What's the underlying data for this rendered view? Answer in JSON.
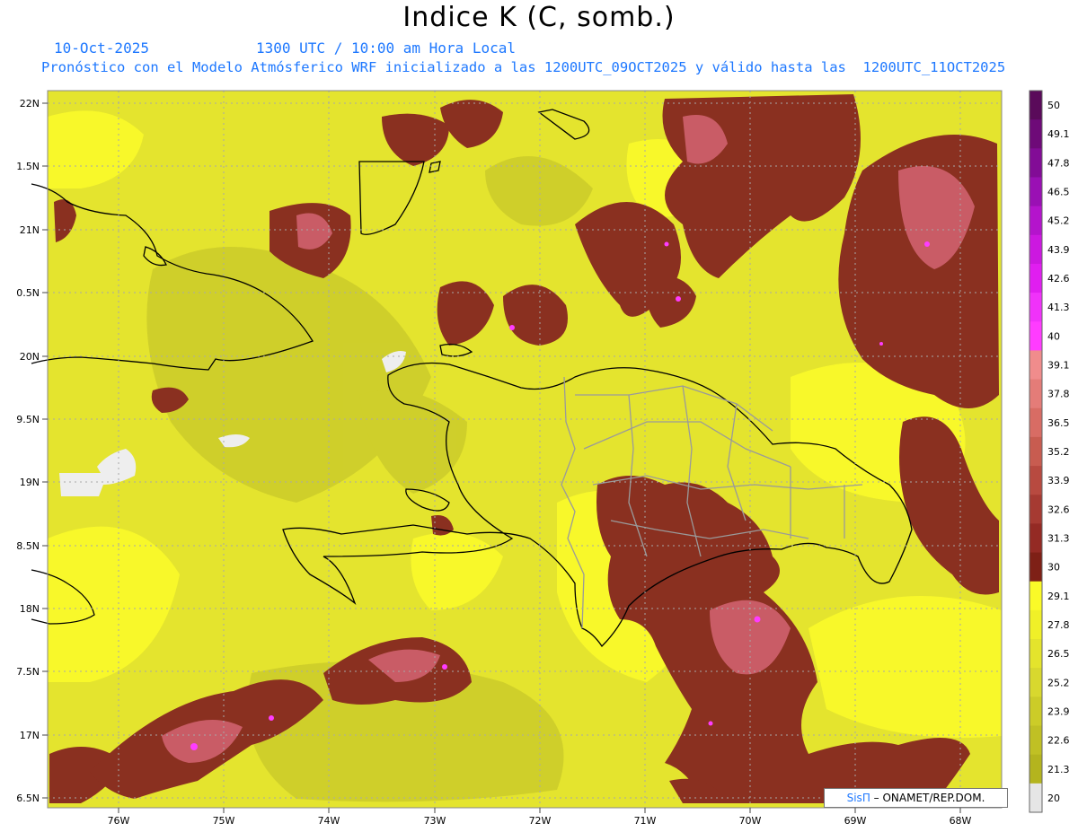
{
  "title": "Indice K (C, somb.)",
  "date_label": "10-Oct-2025",
  "time_label": "1300 UTC / 10:00 am Hora Local",
  "forecast_line": "Pronóstico con el Modelo Atmósferico WRF inicializado a las 1200UTC_09OCT2025 y válido hasta las  1200UTC_11OCT2025",
  "credit": {
    "logo": "SisΠ",
    "text": "– ONAMET/REP.DOM."
  },
  "lat_labels": [
    "22N",
    "1.5N",
    "21N",
    "0.5N",
    "20N",
    "9.5N",
    "19N",
    "8.5N",
    "18N",
    "7.5N",
    "17N",
    "6.5N"
  ],
  "lon_labels": [
    "76W",
    "75W",
    "74W",
    "73W",
    "72W",
    "71W",
    "70W",
    "69W",
    "68W"
  ],
  "colorbar": {
    "labels": [
      "50",
      "49.1",
      "47.8",
      "46.5",
      "45.2",
      "43.9",
      "42.6",
      "41.3",
      "40",
      "39.1",
      "37.8",
      "36.5",
      "35.2",
      "33.9",
      "32.6",
      "31.3",
      "30",
      "29.1",
      "27.8",
      "26.5",
      "25.2",
      "23.9",
      "22.6",
      "21.3",
      "20"
    ],
    "colors": [
      "#5a0a5a",
      "#6e0a78",
      "#820c96",
      "#9a10b4",
      "#b414cc",
      "#cc18e0",
      "#e01ef0",
      "#f032fa",
      "#ff3cff",
      "#f08c8c",
      "#e47c78",
      "#d86c64",
      "#c85c50",
      "#b84a40",
      "#a63a32",
      "#942a24",
      "#7e2016",
      "#fafa28",
      "#f0f028",
      "#e4e42c",
      "#d8d82e",
      "#cccc28",
      "#c0c024",
      "#b4b41e",
      "#e6e6e6"
    ]
  },
  "colors": {
    "background_field": "#e2e22e",
    "dark_field": "#c4c428",
    "warm_field": "#8a3020",
    "hot_field": "#d8647a",
    "peak": "#ff3cff"
  }
}
